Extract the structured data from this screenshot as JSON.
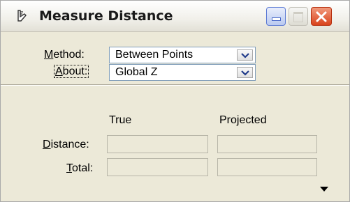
{
  "window": {
    "title": "Measure Distance",
    "title_icon": "measure-tool-icon",
    "controls": [
      "minimize-icon",
      "maximize-icon",
      "close-icon"
    ]
  },
  "form": {
    "method": {
      "label_accel": "M",
      "label_rest": "ethod:",
      "value": "Between Points"
    },
    "about": {
      "label_accel": "A",
      "label_rest": "bout:",
      "value": "Global Z"
    }
  },
  "results": {
    "columns": {
      "true": "True",
      "projected": "Projected"
    },
    "rows": [
      {
        "accel": "D",
        "rest": "istance:",
        "true_value": "",
        "projected_value": ""
      },
      {
        "accel": "T",
        "rest": "otal:",
        "true_value": "",
        "projected_value": ""
      }
    ]
  },
  "footer": {
    "collapse_icon": "expand-down-arrow-icon"
  }
}
